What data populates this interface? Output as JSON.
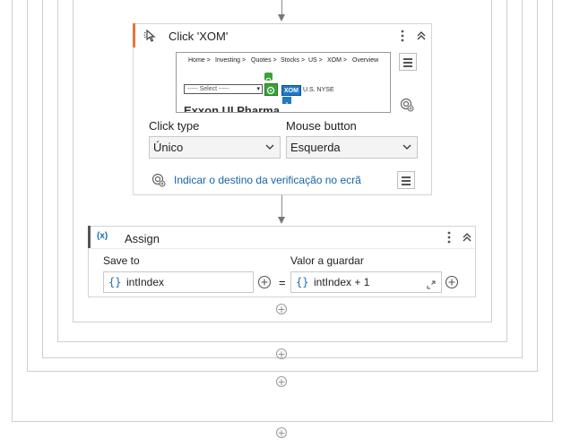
{
  "click_activity": {
    "title": "Click 'XOM'",
    "screenshot": {
      "breadcrumbs": [
        "Home >",
        "Investing >",
        "Quotes >",
        "Stocks >",
        "US >",
        "XOM >",
        "Overview"
      ],
      "select_text": "----- Select -----",
      "ticker_badge": "XOM",
      "exchange": "U.S. NYSE",
      "company_text": "Exxon UI Pharma"
    },
    "click_type_label": "Click type",
    "click_type_value": "Único",
    "mouse_button_label": "Mouse button",
    "mouse_button_value": "Esquerda",
    "verify_target_link": "Indicar o destino da verificação no ecrã"
  },
  "assign_activity": {
    "badge": "(x)",
    "title": "Assign",
    "save_to_label": "Save to",
    "save_to_value": "intIndex",
    "value_label": "Valor a guardar",
    "value_value": "intIndex + 1",
    "equals": "=",
    "braces": "{}"
  },
  "icons": {
    "more": "more-vertical-icon",
    "collapse": "chevron-double-up-icon",
    "add": "plus-circle-icon",
    "menu": "hamburger-menu-icon",
    "target": "target-icon",
    "expand": "expand-icon"
  },
  "colors": {
    "accent_orange": "#e8743b",
    "accent_blue": "#1a6fb3",
    "badge_blue": "#1f78c8",
    "selection_green": "#3aa33a"
  }
}
